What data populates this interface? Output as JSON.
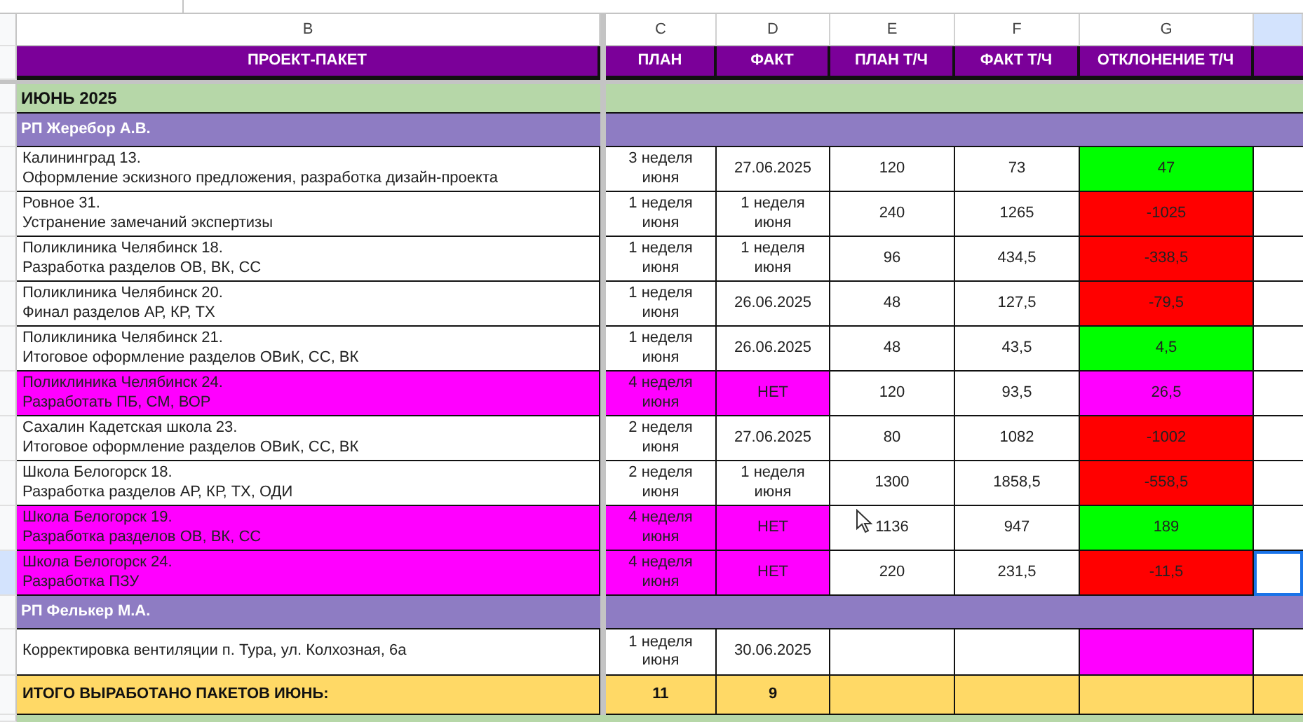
{
  "column_headers": [
    {
      "label": "B",
      "selected": false
    },
    {
      "label": "C",
      "selected": false
    },
    {
      "label": "D",
      "selected": false
    },
    {
      "label": "E",
      "selected": false
    },
    {
      "label": "F",
      "selected": false
    },
    {
      "label": "G",
      "selected": false
    },
    {
      "selected": true
    }
  ],
  "header": [
    "ПРОЕКТ-ПАКЕТ",
    "ПЛАН",
    "ФАКТ",
    "ПЛАН Т/Ч",
    "ФАКТ Т/Ч",
    "ОТКЛОНЕНИЕ Т/Ч"
  ],
  "rows": [
    {
      "kind": "month",
      "title": "ИЮНЬ 2025"
    },
    {
      "kind": "manager",
      "title": "РП Жеребор А.В."
    },
    {
      "kind": "task",
      "selected": false,
      "cells": [
        {
          "text": "Калининград 13.\nОформление эскизного предложения, разработка дизайн-проекта",
          "color": "#ffffff"
        },
        {
          "text": "3 неделя\nиюня",
          "color": "#ffffff"
        },
        {
          "text": "27.06.2025",
          "color": "#ffffff"
        },
        {
          "text": "120",
          "color": "#ffffff"
        },
        {
          "text": "73",
          "color": "#ffffff"
        },
        {
          "text": "47",
          "color": "#00ff00"
        }
      ]
    },
    {
      "kind": "task",
      "selected": false,
      "cells": [
        {
          "text": "Ровное 31.\nУстранение замечаний экспертизы",
          "color": "#ffffff"
        },
        {
          "text": "1 неделя\nиюня",
          "color": "#ffffff"
        },
        {
          "text": "1 неделя\nиюня",
          "color": "#ffffff"
        },
        {
          "text": "240",
          "color": "#ffffff"
        },
        {
          "text": "1265",
          "color": "#ffffff"
        },
        {
          "text": "-1025",
          "color": "#ff0000"
        }
      ]
    },
    {
      "kind": "task",
      "selected": false,
      "cells": [
        {
          "text": "Поликлиника Челябинск 18.\nРазработка разделов ОВ, ВК, СС",
          "color": "#ffffff"
        },
        {
          "text": "1 неделя\nиюня",
          "color": "#ffffff"
        },
        {
          "text": "1 неделя\nиюня",
          "color": "#ffffff"
        },
        {
          "text": "96",
          "color": "#ffffff"
        },
        {
          "text": "434,5",
          "color": "#ffffff"
        },
        {
          "text": "-338,5",
          "color": "#ff0000"
        }
      ]
    },
    {
      "kind": "task",
      "selected": false,
      "cells": [
        {
          "text": "Поликлиника Челябинск 20.\nФинал разделов АР, КР, ТХ",
          "color": "#ffffff"
        },
        {
          "text": "1 неделя\nиюня",
          "color": "#ffffff"
        },
        {
          "text": "26.06.2025",
          "color": "#ffffff"
        },
        {
          "text": "48",
          "color": "#ffffff"
        },
        {
          "text": "127,5",
          "color": "#ffffff"
        },
        {
          "text": "-79,5",
          "color": "#ff0000"
        }
      ]
    },
    {
      "kind": "task",
      "selected": false,
      "cells": [
        {
          "text": "Поликлиника Челябинск 21.\nИтоговое оформление разделов ОВиК, СС, ВК",
          "color": "#ffffff"
        },
        {
          "text": "1 неделя\nиюня",
          "color": "#ffffff"
        },
        {
          "text": "26.06.2025",
          "color": "#ffffff"
        },
        {
          "text": "48",
          "color": "#ffffff"
        },
        {
          "text": "43,5",
          "color": "#ffffff"
        },
        {
          "text": "4,5",
          "color": "#00ff00"
        }
      ]
    },
    {
      "kind": "task",
      "selected": false,
      "cells": [
        {
          "text": "Поликлиника Челябинск 24.\nРазработать ПБ, СМ, ВОР",
          "color": "#ff00ff"
        },
        {
          "text": "4 неделя\nиюня",
          "color": "#ff00ff"
        },
        {
          "text": "НЕТ",
          "color": "#ff00ff"
        },
        {
          "text": "120",
          "color": "#ffffff"
        },
        {
          "text": "93,5",
          "color": "#ffffff"
        },
        {
          "text": "26,5",
          "color": "#ff00ff"
        }
      ]
    },
    {
      "kind": "task",
      "selected": false,
      "cells": [
        {
          "text": "Сахалин Кадетская школа  23.\nИтоговое оформление разделов ОВиК, СС, ВК",
          "color": "#ffffff"
        },
        {
          "text": "2 неделя\nиюня",
          "color": "#ffffff"
        },
        {
          "text": "27.06.2025",
          "color": "#ffffff"
        },
        {
          "text": "80",
          "color": "#ffffff"
        },
        {
          "text": "1082",
          "color": "#ffffff"
        },
        {
          "text": "-1002",
          "color": "#ff0000"
        }
      ]
    },
    {
      "kind": "task",
      "selected": false,
      "cells": [
        {
          "text": "Школа Белогорск 18.\nРазработка разделов АР, КР, ТХ, ОДИ",
          "color": "#ffffff"
        },
        {
          "text": "2 неделя\nиюня",
          "color": "#ffffff"
        },
        {
          "text": "1 неделя\nиюня",
          "color": "#ffffff"
        },
        {
          "text": "1300",
          "color": "#ffffff"
        },
        {
          "text": "1858,5",
          "color": "#ffffff"
        },
        {
          "text": "-558,5",
          "color": "#ff0000"
        }
      ]
    },
    {
      "kind": "task",
      "selected": false,
      "cells": [
        {
          "text": "Школа Белогорск 19.\nРазработка разделов ОВ, ВК, СС",
          "color": "#ff00ff"
        },
        {
          "text": "4 неделя\nиюня",
          "color": "#ff00ff"
        },
        {
          "text": "НЕТ",
          "color": "#ff00ff"
        },
        {
          "text": "1136",
          "color": "#ffffff"
        },
        {
          "text": "947",
          "color": "#ffffff"
        },
        {
          "text": "189",
          "color": "#00ff00"
        }
      ]
    },
    {
      "kind": "task",
      "selected": true,
      "cells": [
        {
          "text": "Школа Белогорск 24.\nРазработка ПЗУ",
          "color": "#ff00ff"
        },
        {
          "text": "4 неделя\nиюня",
          "color": "#ff00ff"
        },
        {
          "text": "НЕТ",
          "color": "#ff00ff"
        },
        {
          "text": "220",
          "color": "#ffffff"
        },
        {
          "text": "231,5",
          "color": "#ffffff"
        },
        {
          "text": "-11,5",
          "color": "#ff0000"
        }
      ]
    },
    {
      "kind": "manager",
      "title": "РП Фелькер М.А."
    },
    {
      "kind": "task",
      "selected": false,
      "cells": [
        {
          "text": "Корректировка вентиляции п. Тура, ул. Колхозная, 6а",
          "color": "#ffffff"
        },
        {
          "text": "1 неделя\nиюня",
          "color": "#ffffff"
        },
        {
          "text": "30.06.2025",
          "color": "#ffffff"
        },
        {
          "color": "#ffffff"
        },
        {
          "color": "#ffffff"
        },
        {
          "color": "#ff00ff"
        }
      ]
    },
    {
      "kind": "total",
      "cells": [
        {
          "text": "ИТОГО ВЫРАБОТАНО ПАКЕТОВ ИЮНЬ:"
        },
        {
          "text": "11"
        },
        {
          "text": "9"
        }
      ]
    }
  ]
}
